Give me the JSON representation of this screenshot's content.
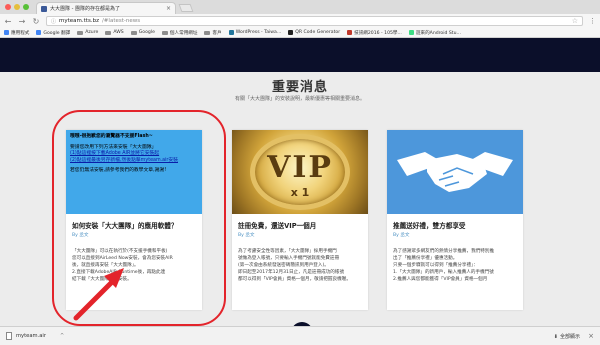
{
  "browser": {
    "tab_title": "大大團隊 - 團隊的存在都是為了",
    "tab_close": "×",
    "url_host": "myteam.tts.bz",
    "url_path": "/#latest-news",
    "nav_back": "←",
    "nav_forward": "→",
    "nav_reload": "↻",
    "star": "☆",
    "menu": "⋮"
  },
  "bookmarks": [
    {
      "label": "應用程式",
      "color": "#4285f4"
    },
    {
      "label": "Google 翻譯",
      "color": "#4285f4"
    },
    {
      "label": "Azure",
      "color": "#8d8d8d"
    },
    {
      "label": "AWS",
      "color": "#8d8d8d"
    },
    {
      "label": "Google",
      "color": "#8d8d8d"
    },
    {
      "label": "個人常用網址",
      "color": "#8d8d8d"
    },
    {
      "label": "客戶",
      "color": "#8d8d8d"
    },
    {
      "label": "WordPress - Taiwa...",
      "color": "#21759b"
    },
    {
      "label": "QR Code Generator",
      "color": "#222222"
    },
    {
      "label": "技訊網2016 - 105學...",
      "color": "#c0392b"
    },
    {
      "label": "遊來的Android Stu...",
      "color": "#3ddc84"
    }
  ],
  "page": {
    "title": "重要消息",
    "subtitle": "有關「大大團隊」的安裝說明，最新優惠等相關重要消息。"
  },
  "cards": [
    {
      "title": "如何安裝「大大團隊」的應用軟體？",
      "author": "By 丞文",
      "flash": {
        "heading": "哦哦-很抱歉您的瀏覽器不支援Flash~",
        "line1": "要請您改用下列方法來安裝「大大團隊」",
        "link1": "(1)點這裡按下載Adobe AIR並將它安裝起",
        "link2": "(2)點這裡最後另存新檔,然後點擊myteam.air安裝",
        "note": "若您仍無法安裝,請參考我們的教學文章,謝謝!"
      },
      "text": [
        "「大大團隊」可以在執行於(不支援手機和平板)",
        "您可以直接到AirLeed Now安裝，會為您安裝AIR",
        "後，就直接再安裝「大大團隊」。",
        "2.直接下載AdobeAIR Runtime後，再點此連",
        "結下載「大大團隊」來安裝。"
      ]
    },
    {
      "title": "註冊免費，還送VIP一個月",
      "author": "By 丞文",
      "vip_text": "VIP",
      "vip_count": "x 1",
      "text": [
        "為了考慮安全性等因素，「大大團隊」採用手機門",
        "號做為登入帳號，只要輸入手機門號就能免費註冊",
        "(第一次會由系統發送密碼簡訊到用戶登入)。",
        "即日起至2017年12月31日止，凡是註冊成功的帳號",
        "都可以得到「VIP會員」資格一個月，敬請把握良機喔。"
      ]
    },
    {
      "title": "推薦送好禮，雙方都享受",
      "author": "By 丞文",
      "text": [
        "為了感謝眾多網友們的熱情分享推薦，我們特別推",
        "出了「推薦份享禮」優惠活動。",
        "只要一個步驟就可以得到「推薦分享禮」：",
        "1.「大大團隊」的新用戶，輸入推薦人的手機門號",
        "2.推薦人與您都能獲得「VIP會員」資格一個月"
      ]
    }
  ],
  "downloads": {
    "file_name": "myteam.air",
    "caret": "^",
    "show_all": "全部顯示",
    "close": "×"
  },
  "colors": {
    "banner": "#0b0f2a",
    "flash_bg": "#41a8ea",
    "annotation": "#e3242b",
    "hands_bg": "#4d97db"
  }
}
